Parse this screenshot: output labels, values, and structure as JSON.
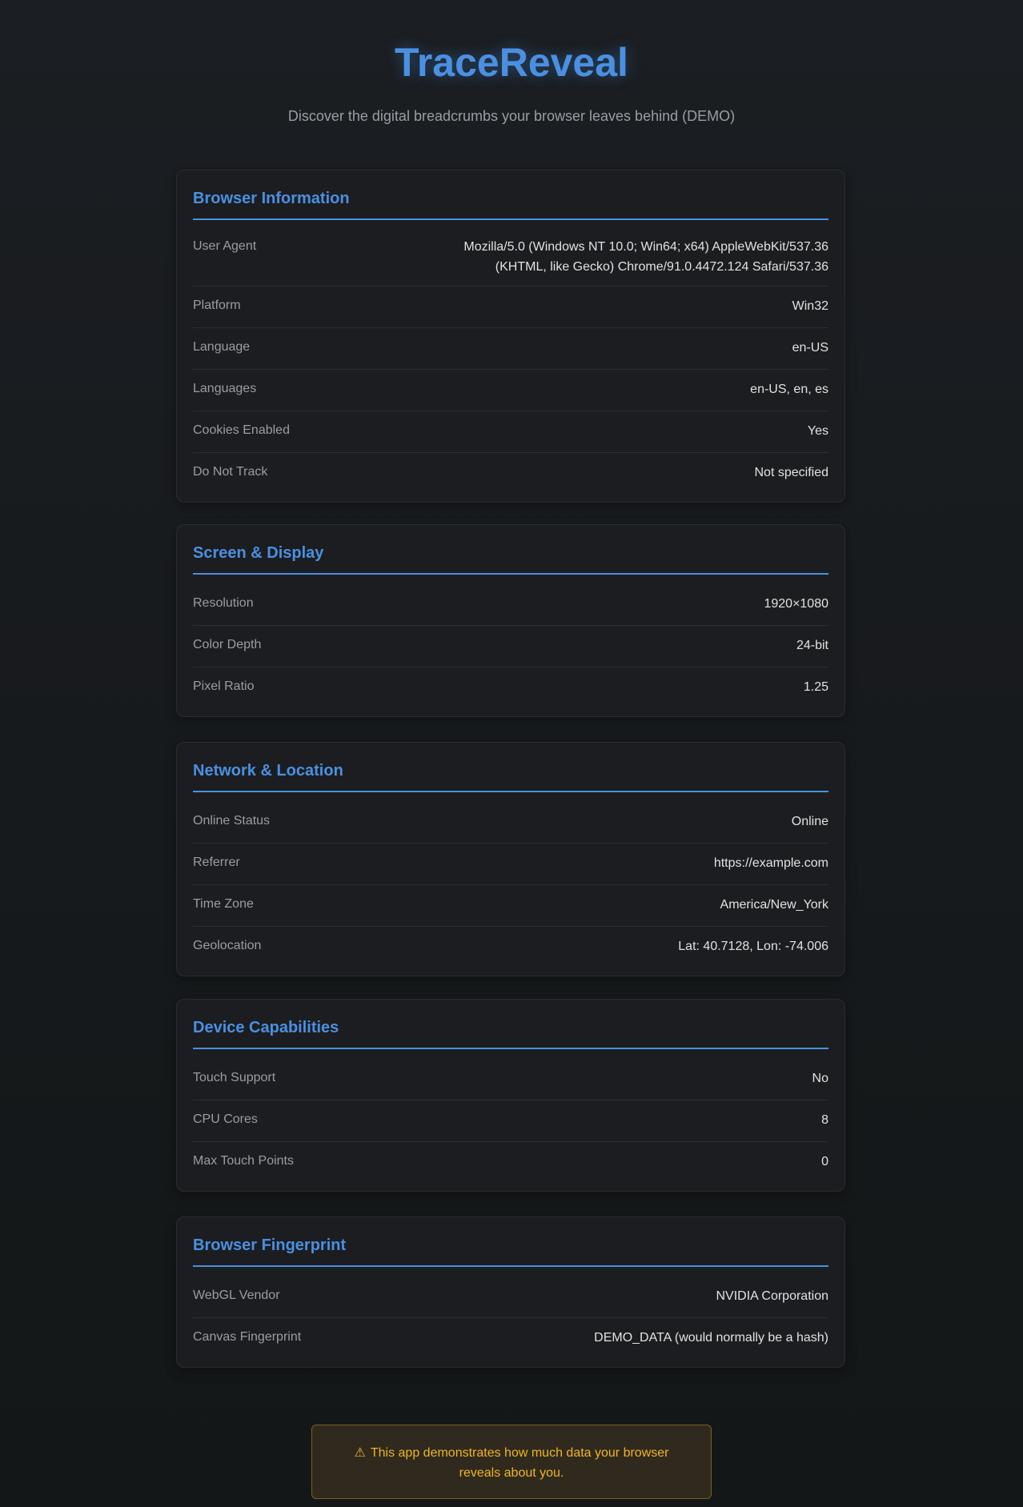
{
  "app": {
    "title": "TraceReveal",
    "subtitle": "Discover the digital breadcrumbs your browser leaves behind (DEMO)"
  },
  "sections": {
    "browser": {
      "title": "Browser Information",
      "rows": [
        {
          "label": "User Agent",
          "value": "Mozilla/5.0 (Windows NT 10.0; Win64; x64) AppleWebKit/537.36 (KHTML, like Gecko) Chrome/91.0.4472.124 Safari/537.36"
        },
        {
          "label": "Platform",
          "value": "Win32"
        },
        {
          "label": "Language",
          "value": "en-US"
        },
        {
          "label": "Languages",
          "value": "en-US, en, es"
        },
        {
          "label": "Cookies Enabled",
          "value": "Yes"
        },
        {
          "label": "Do Not Track",
          "value": "Not specified"
        }
      ]
    },
    "screen": {
      "title": "Screen & Display",
      "rows": [
        {
          "label": "Resolution",
          "value": "1920×1080"
        },
        {
          "label": "Color Depth",
          "value": "24-bit"
        },
        {
          "label": "Pixel Ratio",
          "value": "1.25"
        }
      ]
    },
    "network": {
      "title": "Network & Location",
      "rows": [
        {
          "label": "Online Status",
          "value": "Online"
        },
        {
          "label": "Referrer",
          "value": "https://example.com"
        },
        {
          "label": "Time Zone",
          "value": "America/New_York"
        },
        {
          "label": "Geolocation",
          "value": "Lat: 40.7128, Lon: -74.006"
        }
      ]
    },
    "device": {
      "title": "Device Capabilities",
      "rows": [
        {
          "label": "Touch Support",
          "value": "No"
        },
        {
          "label": "CPU Cores",
          "value": "8"
        },
        {
          "label": "Max Touch Points",
          "value": "0"
        }
      ]
    },
    "fingerprint": {
      "title": "Browser Fingerprint",
      "rows": [
        {
          "label": "WebGL Vendor",
          "value": "NVIDIA Corporation"
        },
        {
          "label": "Canvas Fingerprint",
          "value": "DEMO_DATA (would normally be a hash)"
        }
      ]
    }
  },
  "warning": {
    "icon": "warning-icon",
    "text": "This app demonstrates how much data your browser reveals about you."
  },
  "colors": {
    "accent": "#4a90e2",
    "warning": "#f1b424",
    "background": "#17191c"
  }
}
